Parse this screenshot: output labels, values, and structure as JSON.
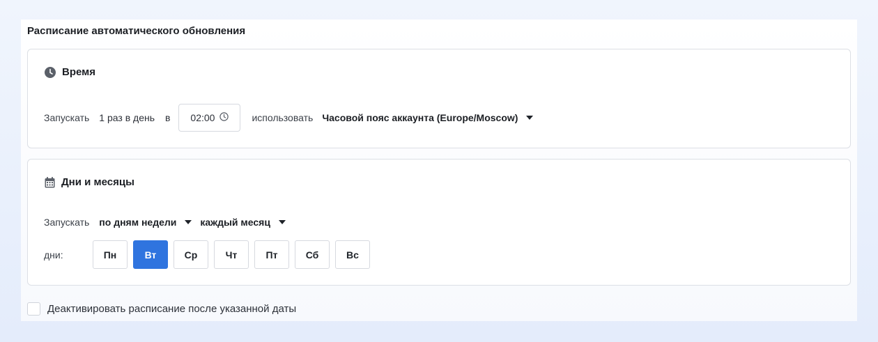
{
  "section": {
    "title": "Расписание автоматического обновления"
  },
  "time_card": {
    "title": "Время",
    "run_label": "Запускать",
    "frequency": "1 раз в день",
    "at_label": "в",
    "time_value": "02:00",
    "use_label": "использовать",
    "timezone": "Часовой пояс аккаунта (Europe/Moscow)"
  },
  "days_card": {
    "title": "Дни и месяцы",
    "run_label": "Запускать",
    "mode": "по дням недели",
    "months": "каждый месяц",
    "days_label": "дни:",
    "days": [
      {
        "label": "Пн",
        "active": false
      },
      {
        "label": "Вт",
        "active": true
      },
      {
        "label": "Ср",
        "active": false
      },
      {
        "label": "Чт",
        "active": false
      },
      {
        "label": "Пт",
        "active": false
      },
      {
        "label": "Сб",
        "active": false
      },
      {
        "label": "Вс",
        "active": false
      }
    ]
  },
  "deactivate": {
    "label": "Деактивировать расписание после указанной даты",
    "checked": false
  },
  "colors": {
    "accent": "#2f74df",
    "border": "#dcdfe5"
  },
  "icons": {
    "time": "clock-icon",
    "days": "calendar-icon",
    "time_input": "clock-outline-icon"
  }
}
